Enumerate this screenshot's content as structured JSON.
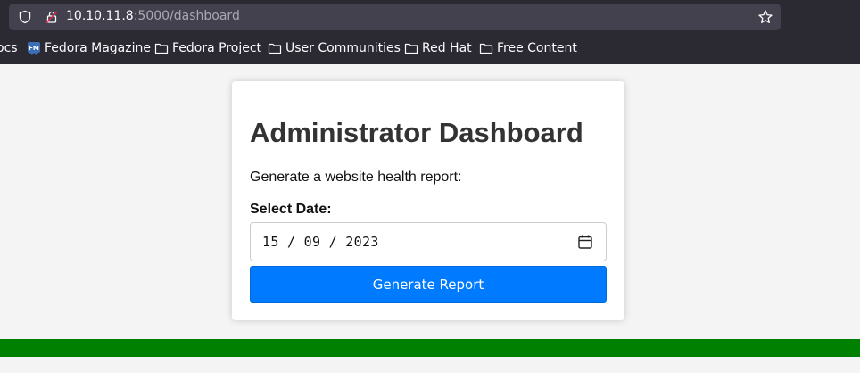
{
  "browser": {
    "url_host": "10.10.11.8",
    "url_path": ":5000/dashboard",
    "bookmarks": [
      {
        "label": "ocs",
        "icon": "folder-icon"
      },
      {
        "label": "Fedora Magazine",
        "icon": "fedora-magazine-icon"
      },
      {
        "label": "Fedora Project",
        "icon": "folder-icon"
      },
      {
        "label": "User Communities",
        "icon": "folder-icon"
      },
      {
        "label": "Red Hat",
        "icon": "folder-icon"
      },
      {
        "label": "Free Content",
        "icon": "folder-icon"
      }
    ]
  },
  "page": {
    "title": "Administrator Dashboard",
    "description": "Generate a website health report:",
    "date_label": "Select Date:",
    "date_value": "15 / 09 / 2023",
    "button_label": "Generate Report"
  },
  "colors": {
    "accent": "#007bff",
    "footer_bar": "#008000"
  }
}
